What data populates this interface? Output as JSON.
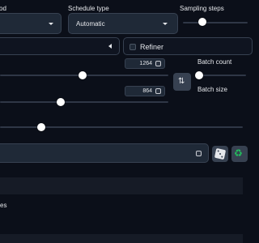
{
  "sampling_method": {
    "label": "od"
  },
  "schedule_type": {
    "label": "Schedule type",
    "value": "Automatic"
  },
  "sampling_steps": {
    "label": "Sampling steps",
    "slider_fraction": 0.3
  },
  "refiner": {
    "label": "Refiner",
    "checked": false
  },
  "width": {
    "value": "1264",
    "slider_fraction": 0.49
  },
  "height": {
    "value": "864",
    "slider_fraction": 0.36
  },
  "batch_count": {
    "label": "Batch count",
    "slider_fraction": 0.04
  },
  "batch_size": {
    "label": "Batch size"
  },
  "cfg_scale": {
    "slider_fraction": 0.17
  },
  "seed": {
    "value": ""
  },
  "partial_label": {
    "text": "es"
  },
  "icons": [
    "dropdown-caret",
    "collapse-arrow",
    "swap-icon",
    "dice-icon",
    "recycle-icon"
  ],
  "colors": {
    "background": "#0b0f19",
    "panel": "#1f2937",
    "accent_green": "#22c55e"
  }
}
